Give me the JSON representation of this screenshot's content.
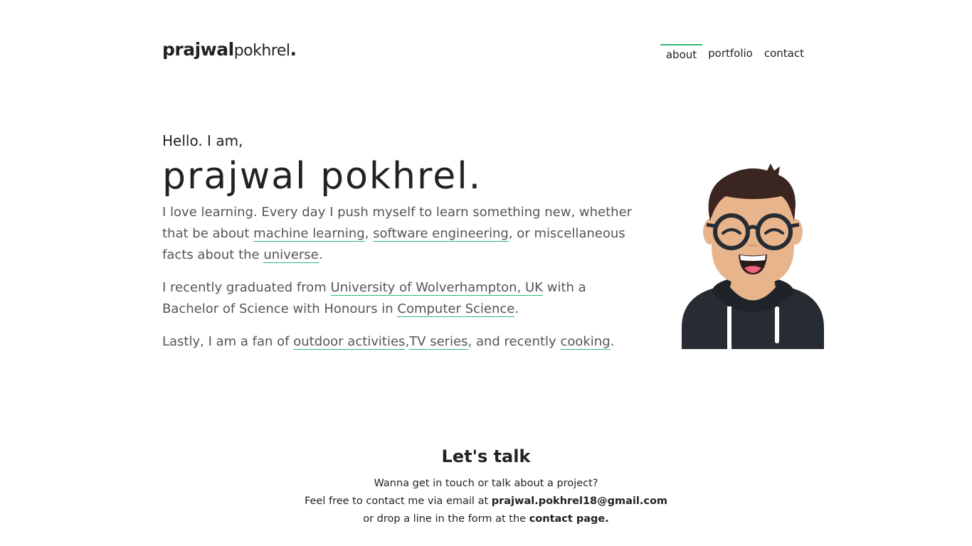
{
  "header": {
    "logo_first": "prajwal",
    "logo_last": "pokhrel",
    "logo_dot": ".",
    "nav": [
      {
        "label": "about",
        "active": true
      },
      {
        "label": "portfolio",
        "active": false
      },
      {
        "label": "contact",
        "active": false
      }
    ]
  },
  "hero": {
    "greeting": "Hello. I am,",
    "name": "prajwal pokhrel.",
    "p1": {
      "t1": "I love learning. Every day I push myself to learn something new, whether that be about ",
      "l1": "machine learning",
      "t2": ", ",
      "l2": "software engineering",
      "t3": ", or miscellaneous facts about the ",
      "l3": "universe",
      "t4": "."
    },
    "p2": {
      "t1": "I recently graduated from ",
      "l1": "University of Wolverhampton, UK",
      "t2": " with a Bachelor of Science with Honours in ",
      "l2": "Computer Science",
      "t3": "."
    },
    "p3": {
      "t1": "Lastly, I am a fan of ",
      "l1": "outdoor activities",
      "t2": ",",
      "l2": "TV series",
      "t3": ", and recently ",
      "l3": "cooking",
      "t4": "."
    }
  },
  "talk": {
    "title": "Let's talk",
    "line1": "Wanna get in touch or talk about a project?",
    "line2_prefix": "Feel free to contact me via email at ",
    "email": "prajwal.pokhrel18@gmail.com",
    "line3_prefix": "or drop a line in the form at the ",
    "contact_link": "contact page."
  },
  "colors": {
    "accent": "#2eb872",
    "text": "#222222",
    "muted": "#555555",
    "skin": "#e8b48c",
    "hair": "#3a2520",
    "hoodie": "#272c33"
  },
  "icons": {
    "avatar": "avatar-illustration"
  }
}
